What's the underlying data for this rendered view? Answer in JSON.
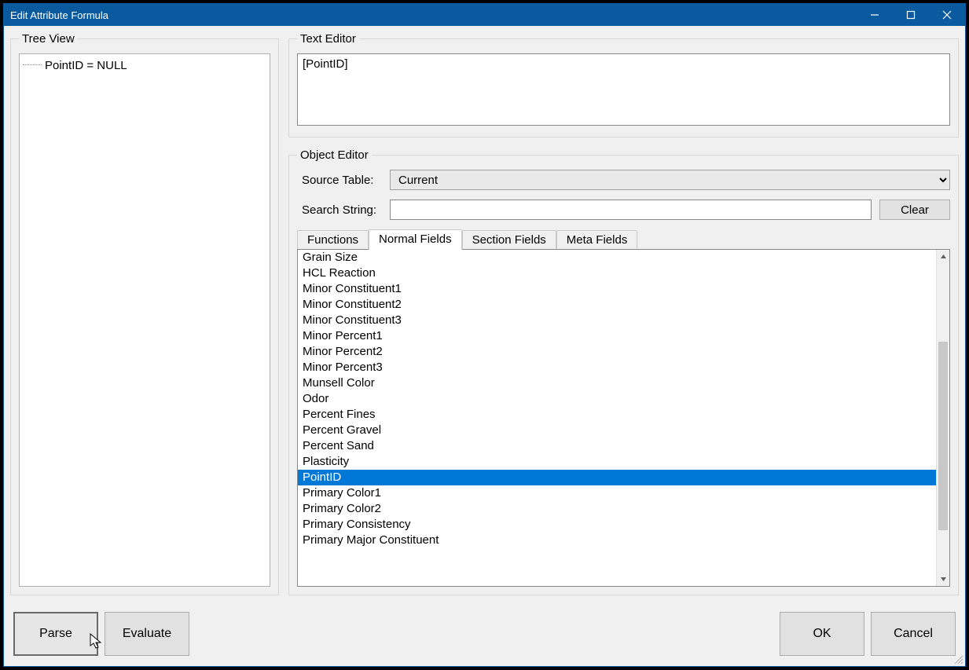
{
  "window": {
    "title": "Edit Attribute Formula"
  },
  "treeView": {
    "legend": "Tree View",
    "rootText": "PointID = NULL"
  },
  "textEditor": {
    "legend": "Text Editor",
    "value": "[PointID]"
  },
  "objectEditor": {
    "legend": "Object Editor",
    "sourceTableLabel": "Source Table:",
    "sourceTableValue": "Current",
    "searchStringLabel": "Search String:",
    "searchStringValue": "",
    "clearLabel": "Clear",
    "tabs": {
      "functions": "Functions",
      "normalFields": "Normal Fields",
      "sectionFields": "Section Fields",
      "metaFields": "Meta Fields",
      "active": "normalFields"
    },
    "fields": [
      "Grain Size",
      "HCL Reaction",
      "Minor Constituent1",
      "Minor Constituent2",
      "Minor Constituent3",
      "Minor Percent1",
      "Minor Percent2",
      "Minor Percent3",
      "Munsell Color",
      "Odor",
      "Percent Fines",
      "Percent Gravel",
      "Percent Sand",
      "Plasticity",
      "PointID",
      "Primary Color1",
      "Primary Color2",
      "Primary Consistency",
      "Primary Major Constituent"
    ],
    "selectedField": "PointID"
  },
  "buttons": {
    "parse": "Parse",
    "evaluate": "Evaluate",
    "ok": "OK",
    "cancel": "Cancel"
  }
}
